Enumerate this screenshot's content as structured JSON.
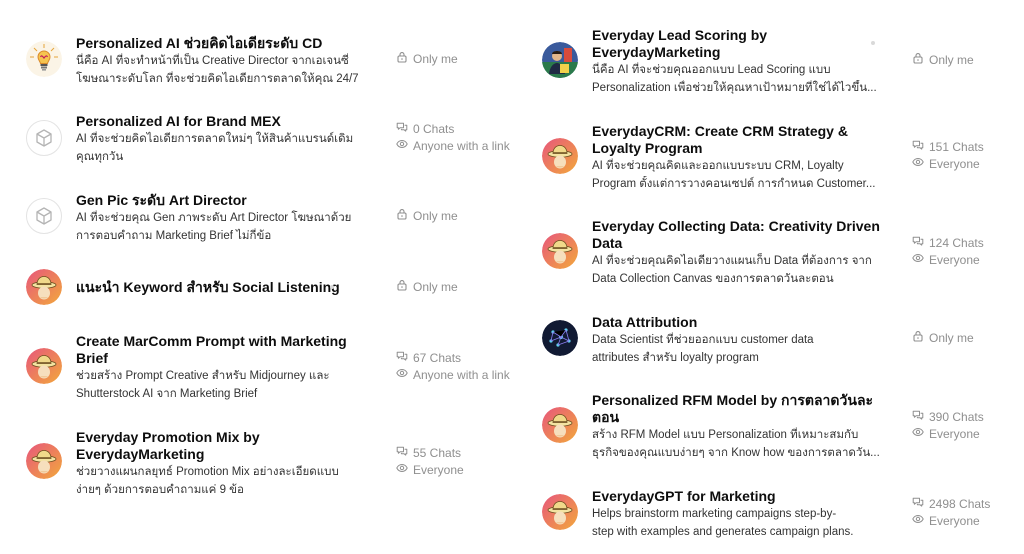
{
  "gpts_left": [
    {
      "title": "Personalized AI ช่วยคิดไอเดียระดับ CD",
      "desc": [
        "นี่คือ AI ที่จะทำหน้าที่เป็น Creative Director จากเอเจนซี่",
        "โฆษณาระดับโลก ที่จะช่วยคิดไอเดียการตลาดให้คุณ 24/7"
      ],
      "visibility": "Only me",
      "chats": "",
      "avatar": "bulb"
    },
    {
      "title": "Personalized AI for Brand MEX",
      "desc": [
        "AI ที่จะช่วยคิดไอเดียการตลาดใหม่ๆ ให้สินค้าแบรนด์เดิม",
        "คุณทุกวัน"
      ],
      "visibility": "Anyone with a link",
      "chats": "0 Chats",
      "avatar": "cube"
    },
    {
      "title": "Gen Pic ระดับ Art Director",
      "desc": [
        "AI ที่จะช่วยคุณ Gen ภาพระดับ Art Director โฆษณาด้วย",
        "การตอบคำถาม Marketing Brief ไม่กี่ข้อ"
      ],
      "visibility": "Only me",
      "chats": "",
      "avatar": "cube"
    },
    {
      "title": "แนะนำ Keyword สำหรับ Social Listening",
      "desc": [],
      "visibility": "Only me",
      "chats": "",
      "avatar": "hat"
    },
    {
      "title": "Create MarComm Prompt with Marketing Brief",
      "desc": [
        "ช่วยสร้าง Prompt Creative สำหรับ Midjourney และ",
        "Shutterstock AI จาก Marketing Brief"
      ],
      "visibility": "Anyone with a link",
      "chats": "67 Chats",
      "avatar": "hat"
    },
    {
      "title": "Everyday Promotion Mix by EverydayMarketing",
      "desc": [
        "ช่วยวางแผนกลยุทธ์ Promotion Mix อย่างละเอียดแบบ",
        "ง่ายๆ ด้วยการตอบคำถามแค่ 9 ข้อ"
      ],
      "visibility": "Everyone",
      "chats": "55 Chats",
      "avatar": "hat"
    }
  ],
  "gpts_right": [
    {
      "title": "Everyday Lead Scoring by EverydayMarketing",
      "desc": [
        "นี่คือ AI ที่จะช่วยคุณออกแบบ Lead Scoring แบบ",
        "Personalization เพื่อช่วยให้คุณหาเป้าหมายที่ใช่ได้ไวขึ้น..."
      ],
      "visibility": "Only me",
      "chats": "",
      "avatar": "person"
    },
    {
      "title": "EverydayCRM: Create CRM Strategy & Loyalty Program",
      "desc": [
        "AI ที่จะช่วยคุณคิดและออกแบบระบบ CRM, Loyalty",
        "Program ตั้งแต่การวางคอนเซปต์ การกำหนด Customer..."
      ],
      "visibility": "Everyone",
      "chats": "151 Chats",
      "avatar": "hat"
    },
    {
      "title": "Everyday Collecting Data: Creativity Driven Data",
      "desc": [
        "AI ที่จะช่วยคุณคิดไอเดียวางแผนเก็บ Data ที่ต้องการ จาก",
        "Data Collection Canvas ของการตลาดวันละตอน"
      ],
      "visibility": "Everyone",
      "chats": "124 Chats",
      "avatar": "hat"
    },
    {
      "title": "Data Attribution",
      "desc": [
        "Data Scientist ที่ช่วยออกแบบ customer data",
        "attributes สำหรับ loyalty program"
      ],
      "visibility": "Only me",
      "chats": "",
      "avatar": "network"
    },
    {
      "title": "Personalized RFM Model by การตลาดวันละ ตอน",
      "desc": [
        "สร้าง RFM Model แบบ Personalization ที่เหมาะสมกับ",
        "ธุรกิจของคุณแบบง่ายๆ จาก Know how ของการตลาดวัน..."
      ],
      "visibility": "Everyone",
      "chats": "390 Chats",
      "avatar": "hat"
    },
    {
      "title": "EverydayGPT for Marketing",
      "desc": [
        "Helps brainstorm marketing campaigns step-by-",
        "step with examples and generates campaign plans."
      ],
      "visibility": "Everyone",
      "chats": "2498 Chats",
      "avatar": "hat"
    }
  ],
  "icons": {
    "lock": "lock-icon",
    "chat": "chat-bubbles-icon",
    "eye": "eye-icon"
  },
  "colors": {
    "title": "#0d0d0d",
    "meta": "#8f8f8f",
    "avatar_gradient_start": "#e7567c",
    "avatar_gradient_end": "#f2a93b"
  }
}
